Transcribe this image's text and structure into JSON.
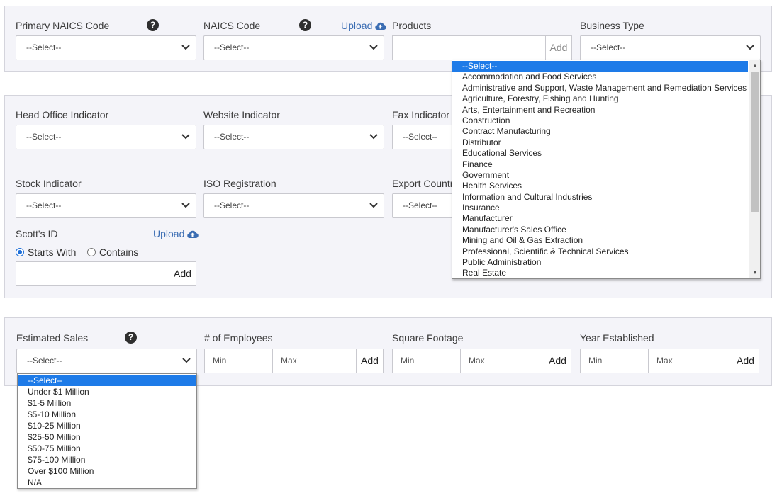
{
  "section1": {
    "primary_naics": {
      "label": "Primary NAICS Code",
      "help": "?",
      "value": "--Select--"
    },
    "naics": {
      "label": "NAICS Code",
      "help": "?",
      "upload": "Upload",
      "value": "--Select--"
    },
    "products": {
      "label": "Products",
      "value": "",
      "add": "Add"
    },
    "business_type": {
      "label": "Business Type",
      "value": "--Select--"
    }
  },
  "section2": {
    "head_office": {
      "label": "Head Office Indicator",
      "value": "--Select--"
    },
    "website": {
      "label": "Website Indicator",
      "value": "--Select--"
    },
    "fax": {
      "label": "Fax Indicator",
      "value": "--Select--"
    },
    "stock": {
      "label": "Stock Indicator",
      "value": "--Select--"
    },
    "iso": {
      "label": "ISO Registration",
      "value": "--Select--"
    },
    "export": {
      "label": "Export Countri",
      "value": "--Select--"
    },
    "scotts_id": {
      "label": "Scott's ID",
      "upload": "Upload",
      "starts_with": "Starts With",
      "contains": "Contains",
      "selected_match": "Starts With",
      "value": "",
      "add": "Add"
    }
  },
  "section3": {
    "estimated_sales": {
      "label": "Estimated Sales",
      "help": "?",
      "value": "--Select--"
    },
    "employees": {
      "label": "# of Employees",
      "min": "Min",
      "max": "Max",
      "add": "Add"
    },
    "square_footage": {
      "label": "Square Footage",
      "min": "Min",
      "max": "Max",
      "add": "Add"
    },
    "year_established": {
      "label": "Year Established",
      "min": "Min",
      "max": "Max",
      "add": "Add"
    }
  },
  "business_type_dropdown": {
    "selected": "--Select--",
    "options": [
      "--Select--",
      "Accommodation and Food Services",
      "Administrative and Support, Waste Management and Remediation Services",
      "Agriculture, Forestry, Fishing and Hunting",
      "Arts, Entertainment and Recreation",
      "Construction",
      "Contract Manufacturing",
      "Distributor",
      "Educational Services",
      "Finance",
      "Government",
      "Health Services",
      "Information and Cultural Industries",
      "Insurance",
      "Manufacturer",
      "Manufacturer's Sales Office",
      "Mining and Oil & Gas Extraction",
      "Professional, Scientific & Technical Services",
      "Public Administration",
      "Real Estate"
    ]
  },
  "sales_dropdown": {
    "selected": "--Select--",
    "options": [
      "--Select--",
      "Under $1 Million",
      "$1-5 Million",
      "$5-10 Million",
      "$10-25 Million",
      "$25-50 Million",
      "$50-75 Million",
      "$75-100 Million",
      "Over $100 Million",
      "N/A"
    ]
  },
  "colors": {
    "accent": "#1e7be8",
    "link": "#3b6db3",
    "panel": "#f4f4f9"
  },
  "icons": {
    "help": "question-circle-icon",
    "upload": "cloud-upload-icon",
    "chevron": "chevron-down-icon"
  }
}
